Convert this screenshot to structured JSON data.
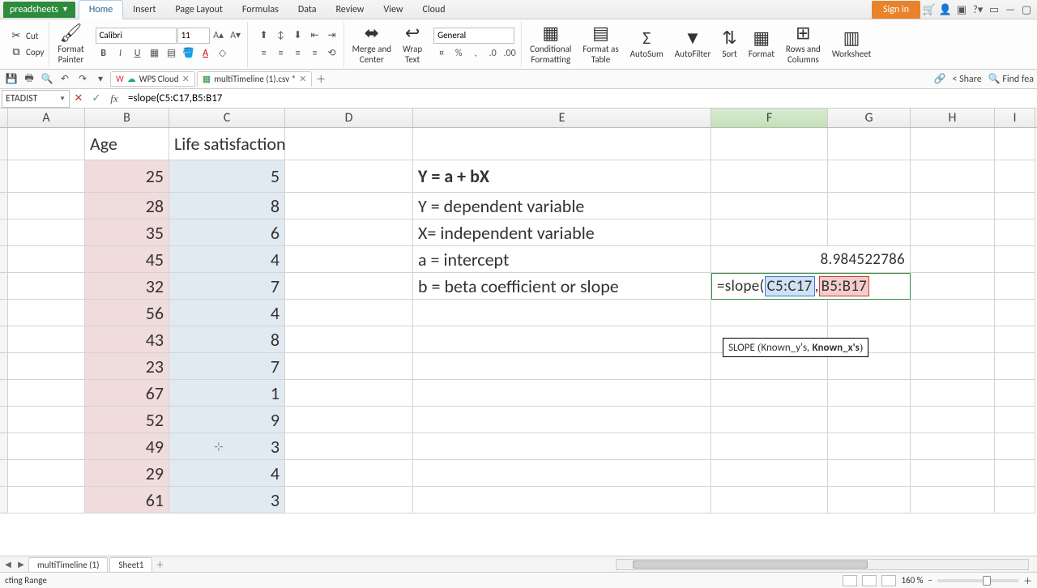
{
  "app": {
    "name": "preadsheets"
  },
  "menu": {
    "items": [
      "Home",
      "Insert",
      "Page Layout",
      "Formulas",
      "Data",
      "Review",
      "View",
      "Cloud"
    ],
    "active": 0,
    "signin": "Sign in"
  },
  "clipboard": {
    "cut": "Cut",
    "copy": "Copy",
    "format_painter": "Format\nPainter"
  },
  "font": {
    "name": "Calibri",
    "size": "11"
  },
  "number_format": "General",
  "ribbon": {
    "merge": "Merge and\nCenter",
    "wrap": "Wrap\nText",
    "cond_fmt": "Conditional\nFormatting",
    "fmt_table": "Format as\nTable",
    "autosum": "AutoSum",
    "autofilter": "AutoFilter",
    "sort": "Sort",
    "format": "Format",
    "rows_cols": "Rows and\nColumns",
    "worksheet": "Worksheet"
  },
  "doctabs": {
    "wps": "WPS Cloud",
    "file": "multiTimeline (1).csv *"
  },
  "doc_right": {
    "share": "Share",
    "find": "Find fea"
  },
  "formula": {
    "name": "ETADIST",
    "text": "=slope(C5:C17,B5:B17"
  },
  "headers": {
    "b": "Age",
    "c": "Life satisfaction"
  },
  "e_text": {
    "eq": "Y = a + bX",
    "y": "Y = dependent variable",
    "x": "X= independent variable",
    "a": "a = intercept",
    "b": "b = beta coefficient or slope"
  },
  "f_vals": {
    "intercept": "8.984522786",
    "formula_pre": "=slope( ",
    "ref_c": "C5:C17",
    "comma": " , ",
    "ref_b": "B5:B17"
  },
  "tooltip": {
    "fn": "SLOPE",
    "ky": "Known_y's",
    "kx": "Known_x's"
  },
  "cols": [
    "A",
    "B",
    "C",
    "D",
    "E",
    "F",
    "G",
    "H",
    "I"
  ],
  "data_rows": [
    {
      "b": "25",
      "c": "5"
    },
    {
      "b": "28",
      "c": "8"
    },
    {
      "b": "35",
      "c": "6"
    },
    {
      "b": "45",
      "c": "4"
    },
    {
      "b": "32",
      "c": "7"
    },
    {
      "b": "56",
      "c": "4"
    },
    {
      "b": "43",
      "c": "8"
    },
    {
      "b": "23",
      "c": "7"
    },
    {
      "b": "67",
      "c": "1"
    },
    {
      "b": "52",
      "c": "9"
    },
    {
      "b": "49",
      "c": "3"
    },
    {
      "b": "29",
      "c": "4"
    },
    {
      "b": "61",
      "c": "3"
    }
  ],
  "sheets": {
    "t1": "multiTimeline (1)",
    "t2": "Sheet1"
  },
  "status": {
    "left": "cting Range",
    "zoom": "160 %"
  }
}
